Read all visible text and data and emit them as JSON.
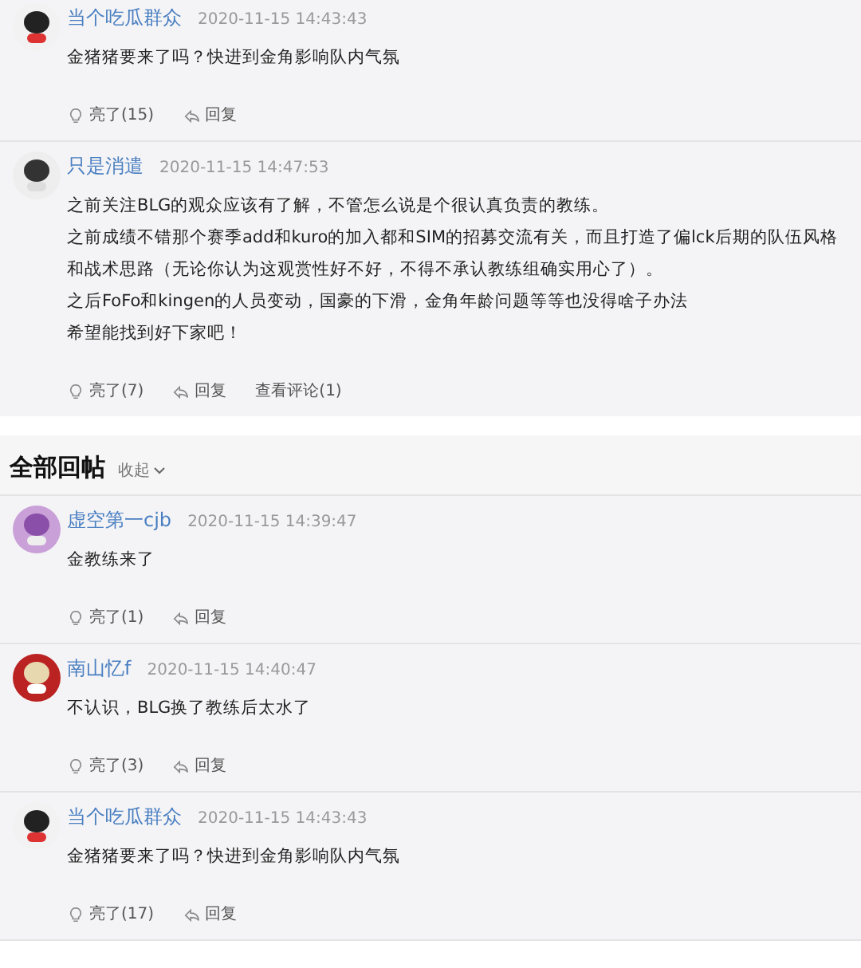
{
  "top_posts": [
    {
      "author": "当个吃瓜群众",
      "time": "2020-11-15 14:43:43",
      "paragraphs": [
        "金猪猪要来了吗？快进到金角影响队内气氛"
      ],
      "like": "亮了(15)",
      "reply": "回复"
    },
    {
      "author": "只是消遣",
      "time": "2020-11-15 14:47:53",
      "paragraphs": [
        "之前关注BLG的观众应该有了解，不管怎么说是个很认真负责的教练。",
        "之前成绩不错那个赛季add和kuro的加入都和SIM的招募交流有关，而且打造了偏lck后期的队伍风格和战术思路（无论你认为这观赏性好不好，不得不承认教练组确实用心了）。",
        "之后FoFo和kingen的人员变动，国豪的下滑，金角年龄问题等等也没得啥子办法",
        "希望能找到好下家吧！"
      ],
      "like": "亮了(7)",
      "reply": "回复",
      "comments": "查看评论(1)"
    }
  ],
  "section": {
    "title": "全部回帖",
    "toggle": "收起"
  },
  "replies": [
    {
      "author": "虚空第一cjb",
      "time": "2020-11-15 14:39:47",
      "paragraphs": [
        "金教练来了"
      ],
      "like": "亮了(1)",
      "reply": "回复"
    },
    {
      "author": "南山忆f",
      "time": "2020-11-15 14:40:47",
      "paragraphs": [
        "不认识，BLG换了教练后太水了"
      ],
      "like": "亮了(3)",
      "reply": "回复"
    },
    {
      "author": "当个吃瓜群众",
      "time": "2020-11-15 14:43:43",
      "paragraphs": [
        "金猪猪要来了吗？快进到金角影响队内气氛"
      ],
      "like": "亮了(17)",
      "reply": "回复"
    }
  ]
}
